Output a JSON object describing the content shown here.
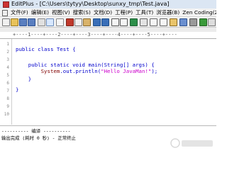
{
  "window": {
    "title": "EditPlus - [C:\\Users\\tytyy\\Desktop\\sunxy_tmp\\Test.java]"
  },
  "menu": {
    "items": [
      "文件(F)",
      "编辑(E)",
      "视图(V)",
      "搜索(S)",
      "文档(D)",
      "工程(P)",
      "工具(T)",
      "浏览器(B)",
      "Zen Coding(Z)"
    ]
  },
  "ruler": {
    "text": "+----1----+----2----+----3----+----4----+----5----+----"
  },
  "editor": {
    "line_numbers": [
      "1",
      "2",
      "3",
      "4",
      "5",
      "6",
      "7",
      "8",
      "9",
      "10"
    ],
    "lines": [
      {
        "text": ""
      },
      {
        "keyword": "public class",
        "rest": " Test {"
      },
      {
        "text": ""
      },
      {
        "keyword": "    public static void",
        "rest": " main(String[] args) {"
      },
      {
        "class_ref": "        System",
        "rest": ".out.println(",
        "string": "\"Hello JavaMan!\"",
        "tail": ");"
      },
      {
        "text": "    }"
      },
      {
        "text": ""
      },
      {
        "text": "}"
      },
      {
        "text": ""
      },
      {
        "text": ""
      }
    ]
  },
  "output": {
    "line1": "---------- 编译 ----------",
    "line2": "输出完成 (耗时 0 秒) - 正常终止"
  },
  "colors": {
    "keyword": "#0000cc",
    "class_ref": "#800000",
    "string": "#cc00cc",
    "line_number": "#888888"
  }
}
